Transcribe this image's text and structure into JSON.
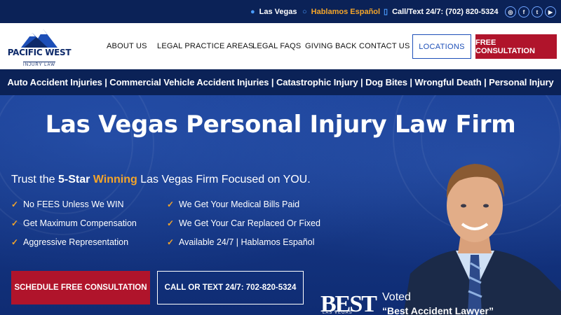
{
  "topbar": {
    "location": "Las Vegas",
    "spanish": "Hablamos Español",
    "call": "Call/Text 24/7: (702) 820-5324",
    "socials": [
      {
        "icon": "instagram-icon",
        "glyph": "◎"
      },
      {
        "icon": "facebook-icon",
        "glyph": "f"
      },
      {
        "icon": "twitter-icon",
        "glyph": "t"
      },
      {
        "icon": "youtube-icon",
        "glyph": "▶"
      }
    ]
  },
  "logo": {
    "name": "PACIFIC WEST",
    "sub": "INJURY LAW"
  },
  "nav": {
    "links": [
      "ABOUT US",
      "LEGAL PRACTICE AREAS",
      "LEGAL FAQS",
      "GIVING BACK",
      "CONTACT US"
    ],
    "locations": "LOCATIONS",
    "free_consultation": "FREE CONSULTATION"
  },
  "practice_strip": "Auto Accident Injuries | Commercial Vehicle Accident Injuries | Catastrophic Injury | Dog Bites | Wrongful Death | Personal Injury",
  "hero": {
    "title": "Las Vegas Personal Injury Law Firm",
    "tagline_pre": "Trust the ",
    "tagline_star": "5-Star",
    "tagline_winning": "Winning",
    "tagline_post": " Las Vegas Firm Focused on YOU.",
    "features": [
      "No FEES Unless We WIN",
      "We Get Your Medical Bills Paid",
      "Get Maximum Compensation",
      "We Get Your Car Replaced Or Fixed",
      "Aggressive Representation",
      "Available 24/7 | Hablamos Español"
    ],
    "schedule_button": "SCHEDULE FREE CONSULTATION",
    "call_button": "CALL OR TEXT 24/7: 702-820-5324",
    "best_badge": "BEST",
    "best_badge_small": "LAS VEGAS",
    "voted": "Voted",
    "voted_quote": "“Best Accident Lawyer”"
  },
  "colors": {
    "navy": "#0b2257",
    "red": "#b0142b",
    "gold": "#f4a52a",
    "blue": "#1d4fb8"
  }
}
